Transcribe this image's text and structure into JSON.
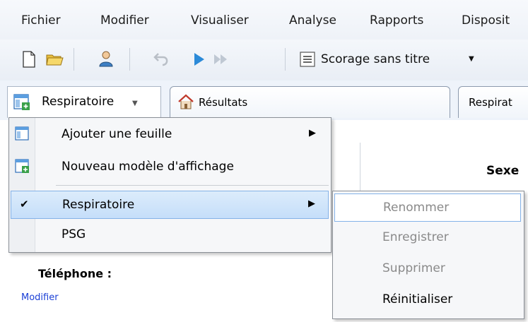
{
  "menubar": {
    "items": [
      "Fichier",
      "Modifier",
      "Visualiser",
      "Analyse",
      "Rapports",
      "Disposit"
    ]
  },
  "toolbar": {
    "scoring_label": "Scorage sans titre",
    "icons": [
      "new-document-icon",
      "open-folder-icon",
      "user-icon",
      "undo-icon",
      "play-icon",
      "fast-forward-icon",
      "list-icon"
    ]
  },
  "tabs": {
    "view_button_label": "Respiratoire",
    "results_tab": "Résultats",
    "resp_tab": "Respirat"
  },
  "content": {
    "sexe_label": "Sexe",
    "phone_label": "Téléphone :",
    "modify_link": "Modifier"
  },
  "dropdown": {
    "items": [
      {
        "label": "Ajouter une feuille",
        "has_submenu": true
      },
      {
        "label": "Nouveau modèle d'affichage",
        "has_submenu": false
      },
      {
        "label": "Respiratoire",
        "has_submenu": true,
        "checked": true
      },
      {
        "label": "PSG",
        "has_submenu": false
      }
    ]
  },
  "submenu": {
    "items": [
      {
        "label": "Renommer",
        "enabled": false
      },
      {
        "label": "Enregistrer",
        "enabled": false
      },
      {
        "label": "Supprimer",
        "enabled": false
      },
      {
        "label": "Réinitialiser",
        "enabled": true
      }
    ]
  },
  "colors": {
    "highlight": "#c5defa",
    "highlight_border": "#84b2e8",
    "link": "#1a3fd6"
  }
}
